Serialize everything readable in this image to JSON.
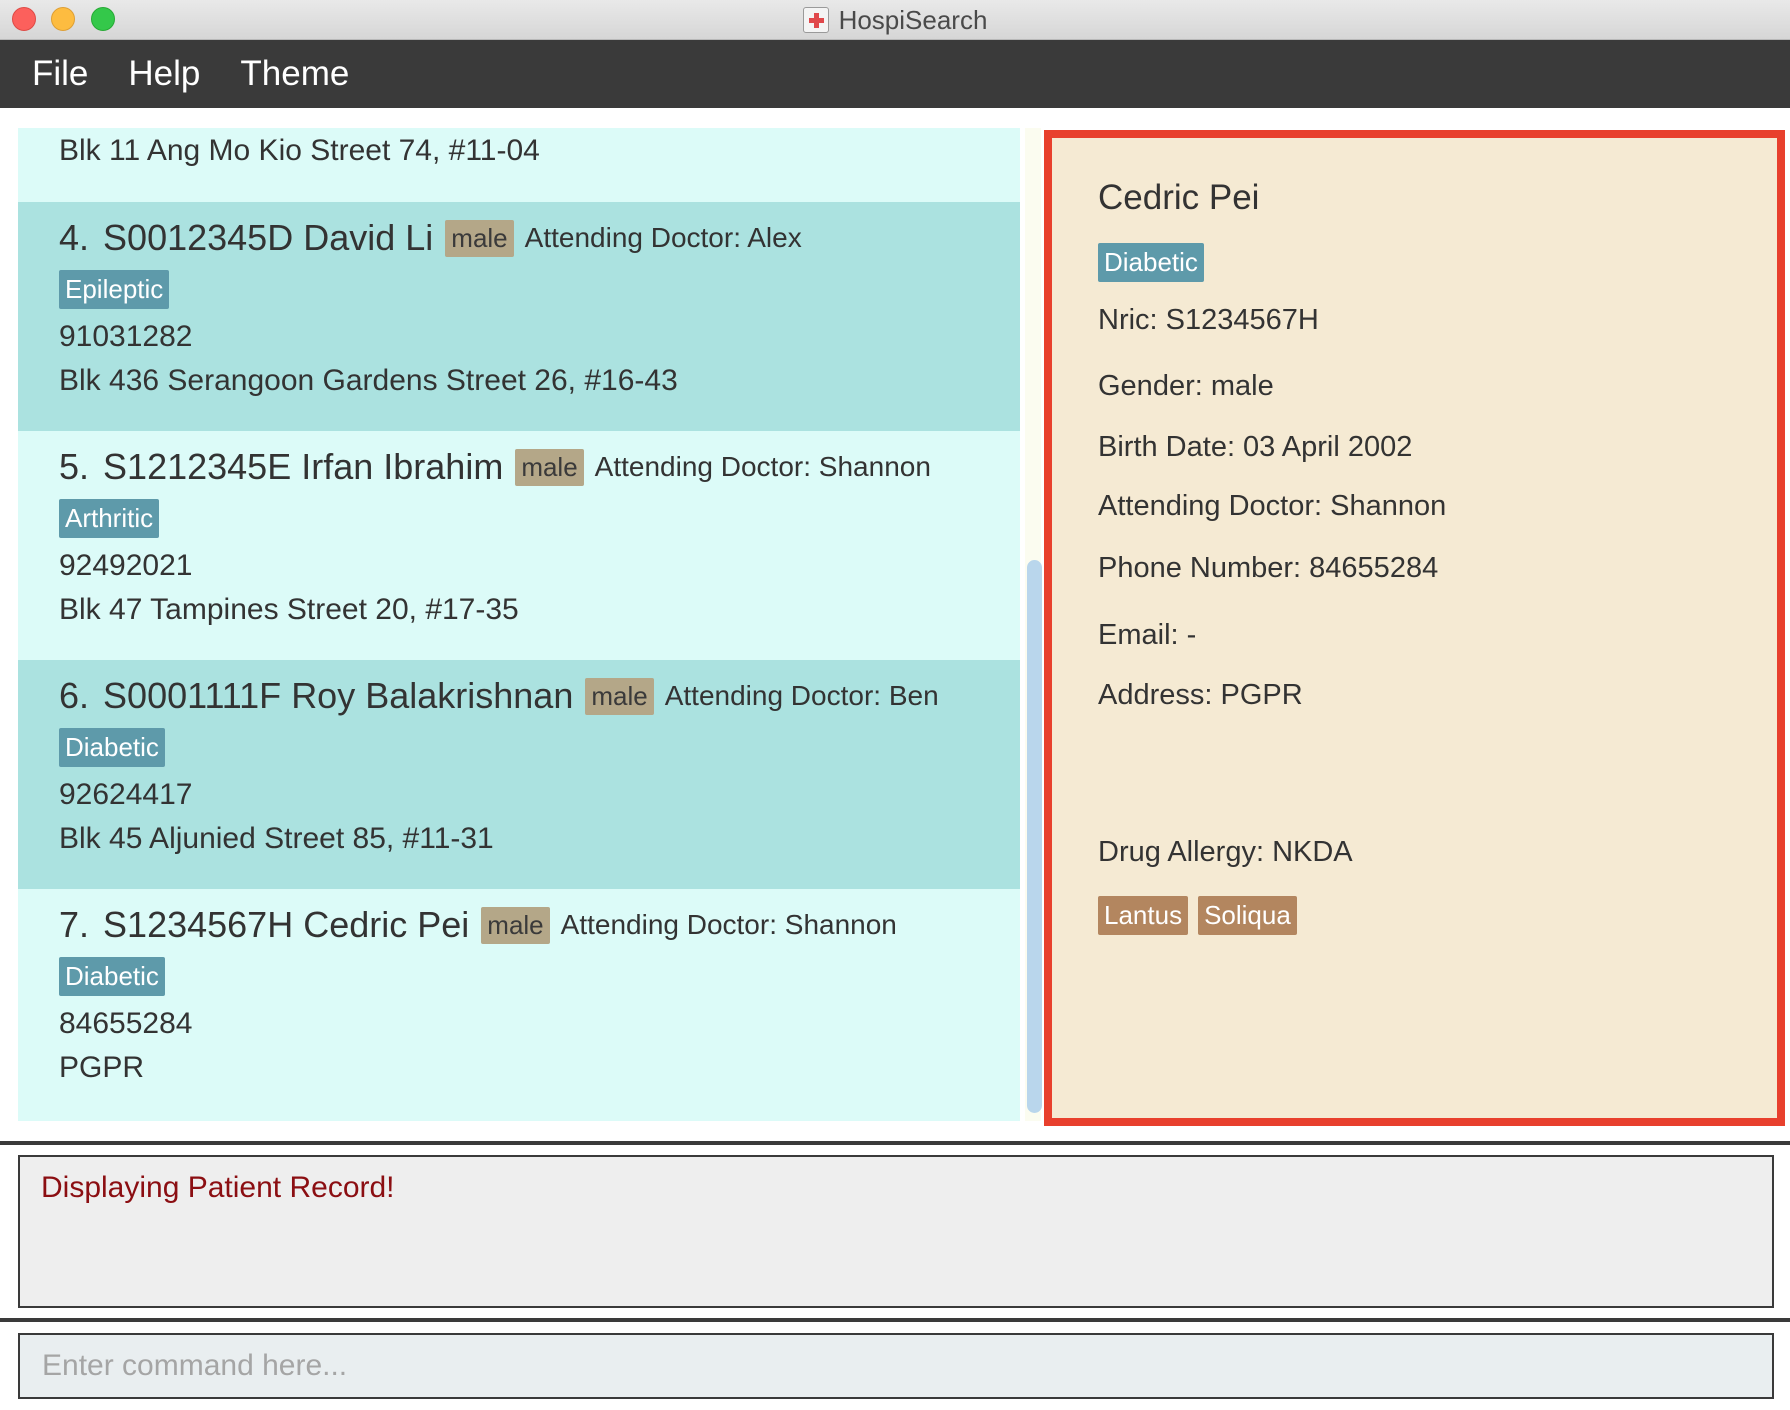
{
  "window": {
    "title": "HospiSearch"
  },
  "menu": {
    "file": "File",
    "help": "Help",
    "theme": "Theme"
  },
  "list": {
    "partial_address": "Blk 11 Ang Mo Kio Street 74, #11-04",
    "patients": [
      {
        "index": "4.",
        "nric": "S0012345D",
        "name": "David Li",
        "gender": "male",
        "doctor": "Attending Doctor: Alex",
        "tag": "Epileptic",
        "phone": "91031282",
        "address": "Blk 436 Serangoon Gardens Street 26, #16-43"
      },
      {
        "index": "5.",
        "nric": "S1212345E",
        "name": "Irfan Ibrahim",
        "gender": "male",
        "doctor": "Attending Doctor: Shannon",
        "tag": "Arthritic",
        "phone": "92492021",
        "address": "Blk 47 Tampines Street 20, #17-35"
      },
      {
        "index": "6.",
        "nric": "S0001111F",
        "name": "Roy Balakrishnan",
        "gender": "male",
        "doctor": "Attending Doctor: Ben",
        "tag": "Diabetic",
        "phone": "92624417",
        "address": "Blk 45 Aljunied Street 85, #11-31"
      },
      {
        "index": "7.",
        "nric": "S1234567H",
        "name": "Cedric Pei",
        "gender": "male",
        "doctor": "Attending Doctor: Shannon",
        "tag": "Diabetic",
        "phone": "84655284",
        "address": "PGPR"
      }
    ]
  },
  "detail": {
    "name": "Cedric Pei",
    "tag": "Diabetic",
    "nric": "Nric: S1234567H",
    "gender": "Gender: male",
    "birth_date": "Birth Date: 03 April 2002",
    "doctor": "Attending Doctor: Shannon",
    "phone": "Phone Number: 84655284",
    "email": "Email: -",
    "address": "Address: PGPR",
    "drug_allergy": "Drug Allergy: NKDA",
    "medicines": [
      "Lantus",
      "Soliqua"
    ]
  },
  "result": {
    "text": "Displaying Patient Record!"
  },
  "command": {
    "placeholder": "Enter command here..."
  }
}
